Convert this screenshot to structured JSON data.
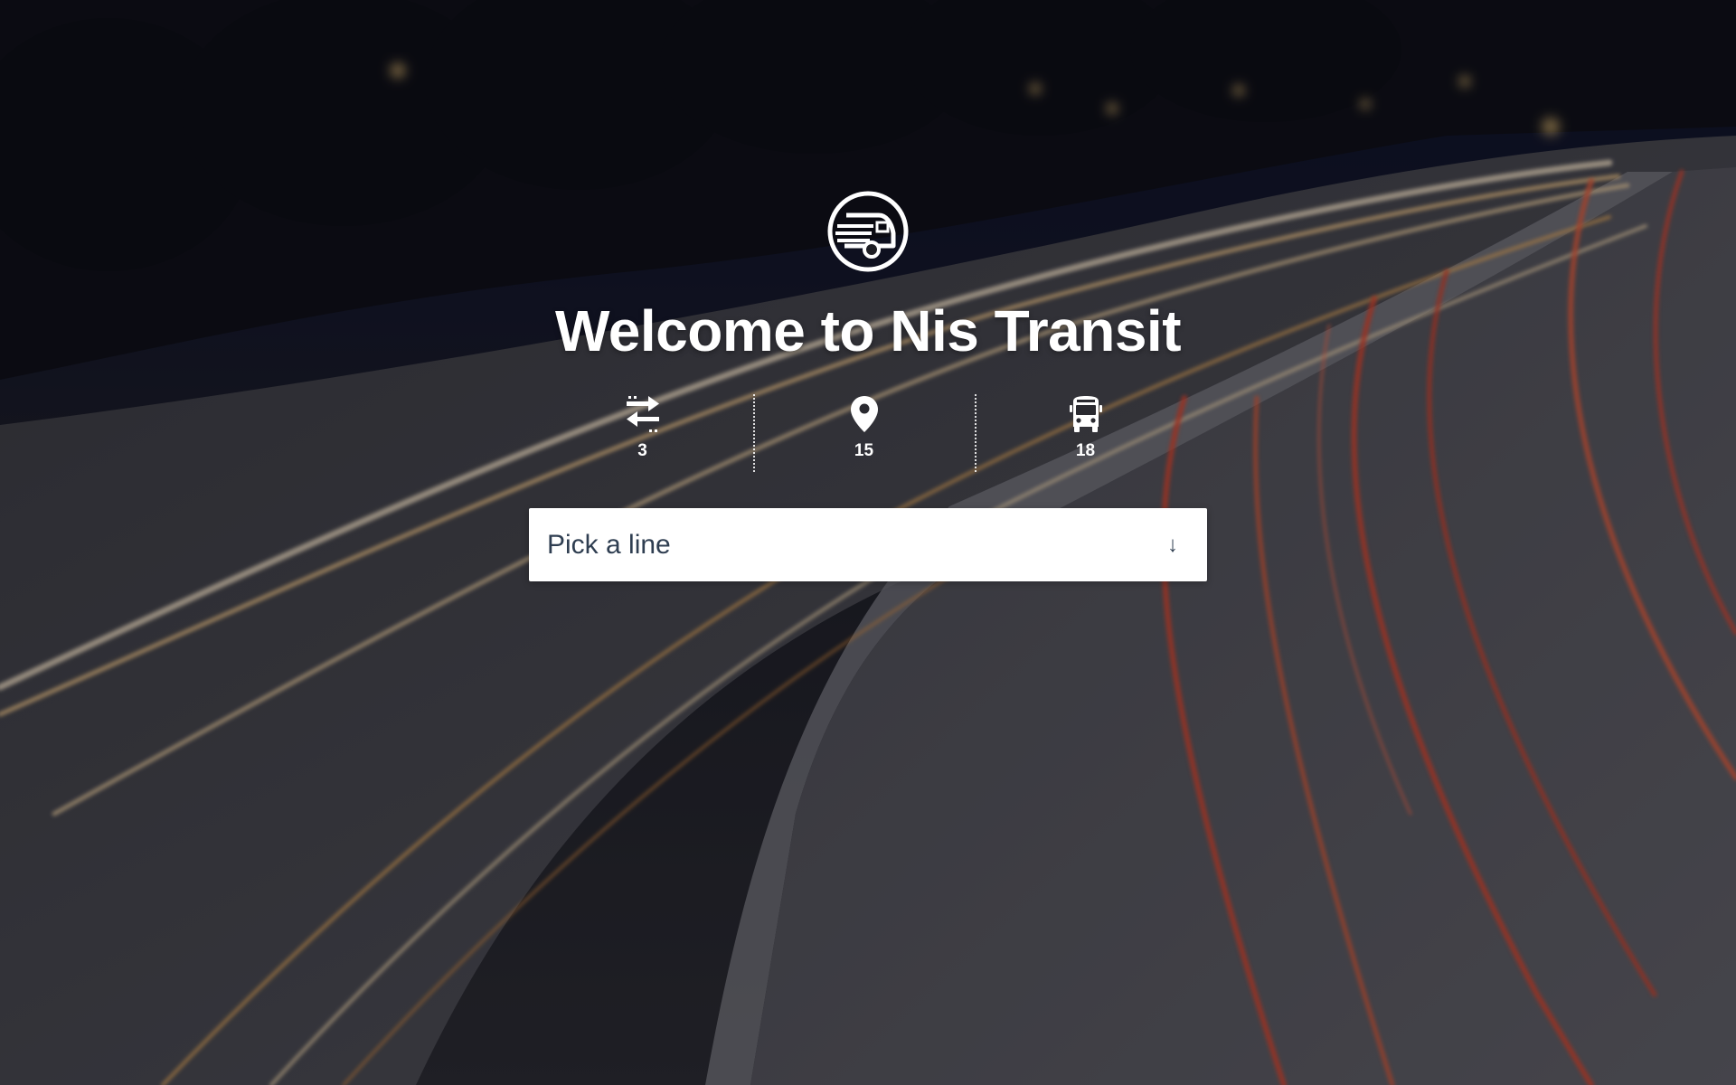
{
  "hero": {
    "background": "night-highway-light-trails-photo",
    "logo_icon": "bus-circle-logo-icon",
    "title": "Welcome to Nis Transit"
  },
  "stats": [
    {
      "icon": "transfer-arrows-icon",
      "value": "3"
    },
    {
      "icon": "location-pin-icon",
      "value": "15"
    },
    {
      "icon": "bus-icon",
      "value": "18"
    }
  ],
  "line_select": {
    "value": "Pick a line",
    "arrow": "↓"
  },
  "colors": {
    "text_light": "#ffffff",
    "select_text": "#2f3e51",
    "select_bg": "#ffffff",
    "light_trail_warm": "#f4c98a",
    "light_trail_red": "#e0452c"
  }
}
